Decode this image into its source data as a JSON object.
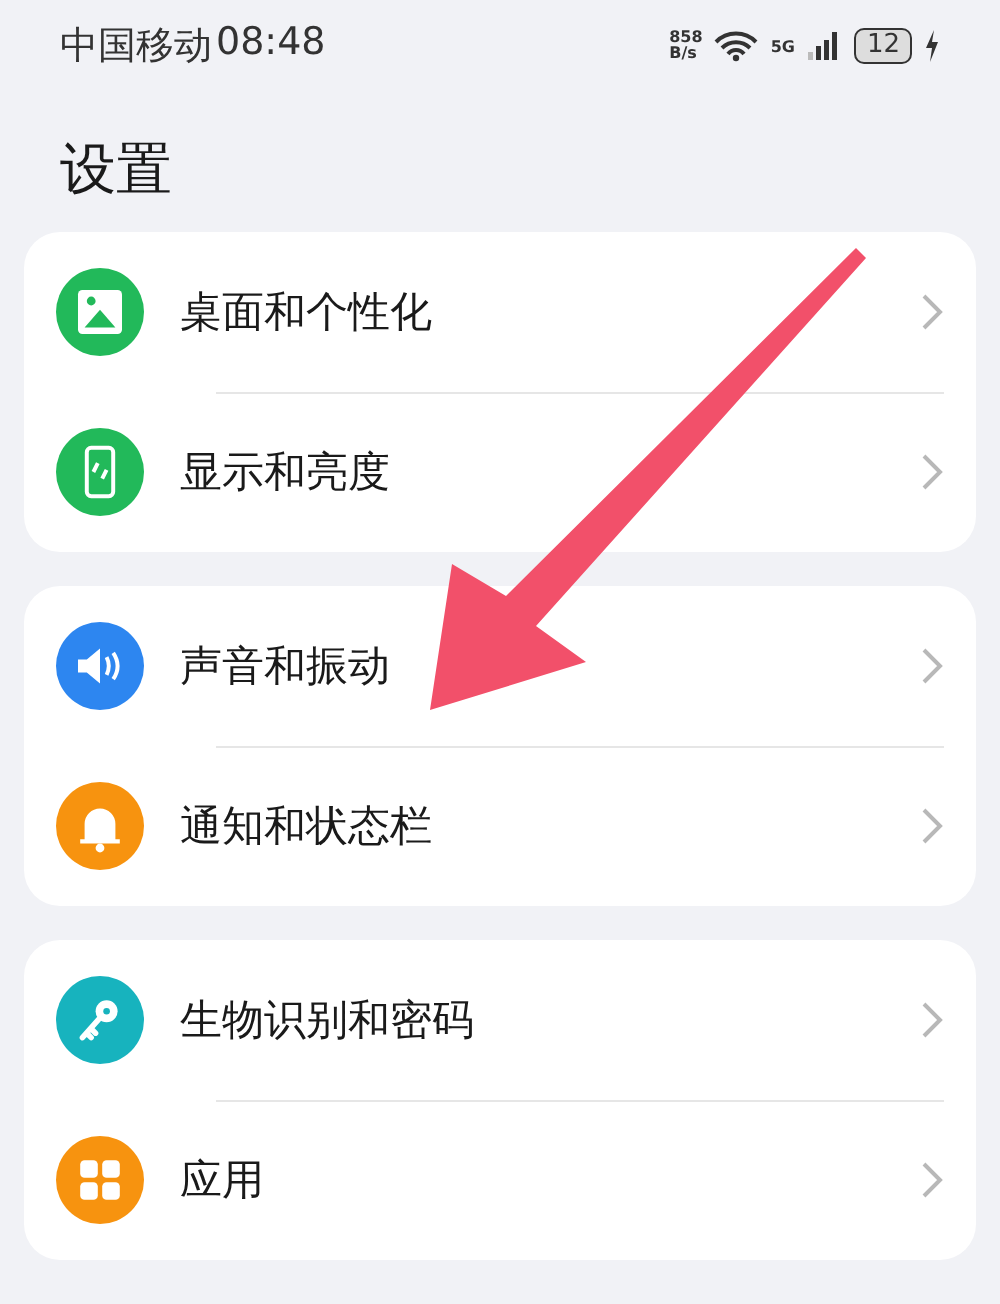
{
  "status_bar": {
    "carrier": "中国移动",
    "time": "08:48",
    "net_speed": "858",
    "net_unit": "B/s",
    "network": "5G",
    "battery": "12"
  },
  "title": "设置",
  "groups": [
    {
      "items": [
        {
          "label": "桌面和个性化",
          "color": "#22b95a"
        },
        {
          "label": "显示和亮度",
          "color": "#22b95a"
        }
      ]
    },
    {
      "items": [
        {
          "label": "声音和振动",
          "color": "#2d86f0"
        },
        {
          "label": "通知和状态栏",
          "color": "#f7930f"
        }
      ]
    },
    {
      "items": [
        {
          "label": "生物识别和密码",
          "color": "#17b3be"
        },
        {
          "label": "应用",
          "color": "#f7930f"
        }
      ]
    }
  ]
}
